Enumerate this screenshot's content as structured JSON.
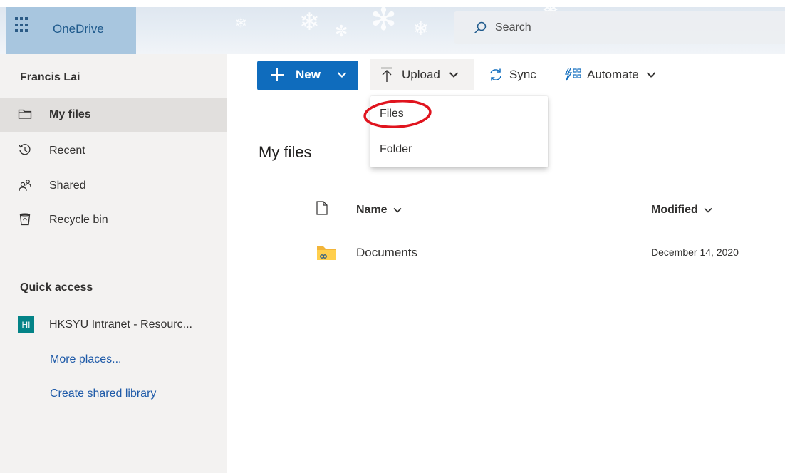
{
  "app": {
    "name": "OneDrive",
    "search_placeholder": "Search"
  },
  "sidebar": {
    "user_name": "Francis Lai",
    "nav": [
      {
        "label": "My files",
        "icon": "folder-icon",
        "active": true
      },
      {
        "label": "Recent",
        "icon": "clock-history-icon",
        "active": false
      },
      {
        "label": "Shared",
        "icon": "people-icon",
        "active": false
      },
      {
        "label": "Recycle bin",
        "icon": "recycle-bin-icon",
        "active": false
      }
    ],
    "quick_access": {
      "heading": "Quick access",
      "site": {
        "badge": "HI",
        "label": "HKSYU Intranet - Resourc...",
        "badge_color": "#038387"
      },
      "more_places": "More places...",
      "create_library": "Create shared library"
    }
  },
  "toolbar": {
    "new_label": "New",
    "upload_label": "Upload",
    "sync_label": "Sync",
    "automate_label": "Automate",
    "accent_color": "#0f6cbd"
  },
  "upload_menu": {
    "items": [
      {
        "label": "Files",
        "highlighted": true
      },
      {
        "label": "Folder",
        "highlighted": false
      }
    ],
    "highlight_color": "#e0141e"
  },
  "main": {
    "title": "My files",
    "columns": {
      "name": "Name",
      "modified": "Modified"
    },
    "rows": [
      {
        "name": "Documents",
        "modified": "December 14, 2020",
        "icon": "shared-folder-icon"
      }
    ]
  }
}
